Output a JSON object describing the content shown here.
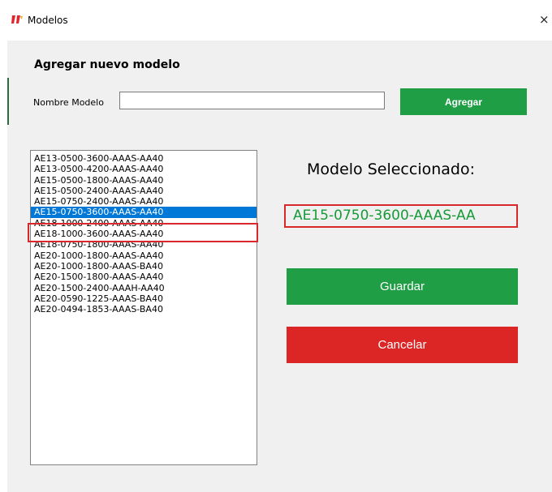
{
  "window": {
    "title": "Modelos",
    "close_glyph": "×",
    "icon": "app-logo-icon",
    "accent_color": "#1f9e46",
    "danger_color": "#dc2626",
    "selection_color": "#0078d7",
    "highlight_color": "#d9282b"
  },
  "add_section": {
    "title": "Agregar nuevo modelo",
    "name_label": "Nombre Modelo",
    "name_value": "",
    "add_label": "Agregar"
  },
  "models": {
    "items": [
      "AE13-0500-3600-AAAS-AA40",
      "AE13-0500-4200-AAAS-AA40",
      "AE15-0500-1800-AAAS-AA40",
      "AE15-0500-2400-AAAS-AA40",
      "AE15-0750-2400-AAAS-AA40",
      "AE15-0750-3600-AAAS-AA40",
      "AE18-1000-2400-AAAS-AA40",
      "AE18-1000-3600-AAAS-AA40",
      "AE18-0750-1800-AAAS-AA40",
      "AE20-1000-1800-AAAS-AA40",
      "AE20-1000-1800-AAAS-BA40",
      "AE20-1500-1800-AAAS-AA40",
      "AE20-1500-2400-AAAH-AA40",
      "AE20-0590-1225-AAAS-BA40",
      "AE20-0494-1853-AAAS-BA40"
    ],
    "selected_index": 5
  },
  "selection": {
    "heading": "Modelo Seleccionado:",
    "value": "AE15-0750-3600-AAAS-AA"
  },
  "actions": {
    "save_label": "Guardar",
    "cancel_label": "Cancelar"
  }
}
